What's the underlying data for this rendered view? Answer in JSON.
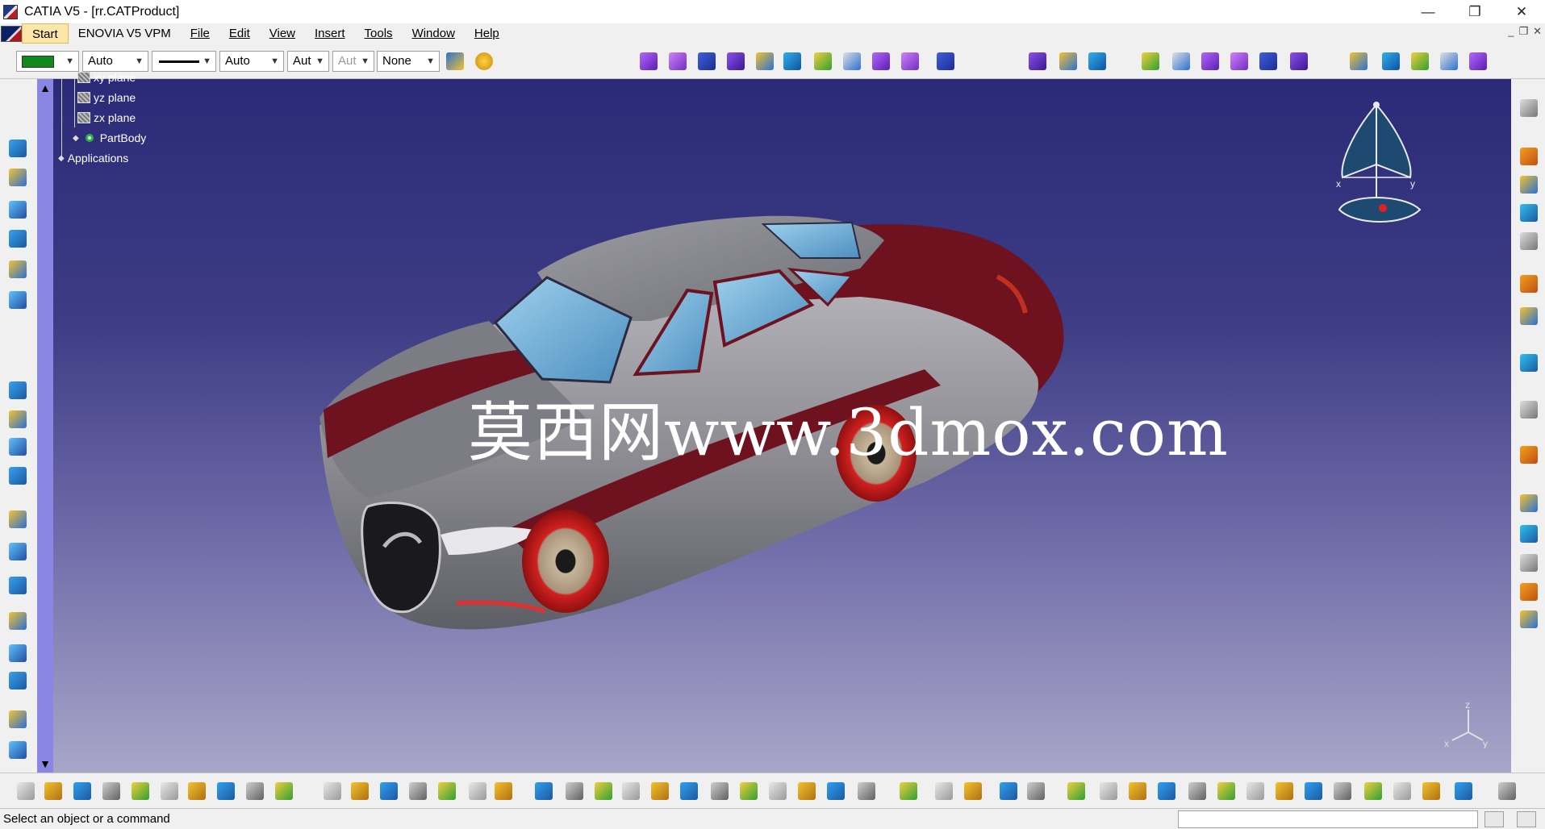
{
  "window": {
    "title": "CATIA V5 - [rr.CATProduct]",
    "minimize": "—",
    "restore": "❐",
    "close": "✕"
  },
  "menu": {
    "items": [
      "Start",
      "ENOVIA V5 VPM",
      "File",
      "Edit",
      "View",
      "Insert",
      "Tools",
      "Window",
      "Help"
    ]
  },
  "properties_toolbar": {
    "color": "#0f8a1f",
    "transparency": "Auto",
    "line_weight": "Auto",
    "line_type_short": "Aut",
    "point_symbol_short": "Aut",
    "layer": "None"
  },
  "tree": {
    "nodes": [
      {
        "label": "xy plane"
      },
      {
        "label": "yz plane"
      },
      {
        "label": "zx plane"
      },
      {
        "label": "PartBody"
      },
      {
        "label": "Applications"
      }
    ]
  },
  "compass_labels": {
    "x": "x",
    "y": "y"
  },
  "triad_labels": {
    "x": "x",
    "y": "y",
    "z": "z"
  },
  "watermark": "莫西网www.3dmox.com",
  "status": {
    "message": "Select an object or a command"
  },
  "colors": {
    "car_body": "#8a8a90",
    "car_accent": "#6e1220",
    "glass": "#6ab0d8",
    "wheel_rim": "#c01818",
    "viewport_top": "#2a2a78",
    "viewport_bottom": "#a8a6c8"
  }
}
